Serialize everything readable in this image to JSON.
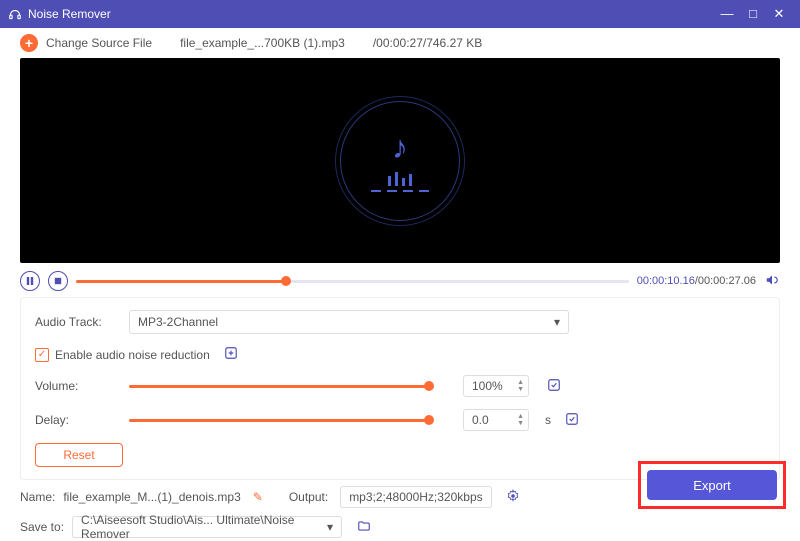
{
  "window": {
    "title": "Noise Remover"
  },
  "topbar": {
    "change_source": "Change Source File",
    "filename": "file_example_...700KB (1).mp3",
    "meta": "/00:00:27/746.27 KB"
  },
  "player": {
    "current": "00:00:10.16",
    "total": "/00:00:27.06",
    "progress_pct": 38
  },
  "audio_track": {
    "label": "Audio Track:",
    "value": "MP3-2Channel"
  },
  "noise": {
    "label": "Enable audio noise reduction",
    "checked": true
  },
  "volume": {
    "label": "Volume:",
    "value": "100%",
    "pct": 100
  },
  "delay": {
    "label": "Delay:",
    "value": "0.0",
    "unit": "s",
    "pct": 100
  },
  "reset": {
    "label": "Reset"
  },
  "name": {
    "label": "Name:",
    "value": "file_example_M...(1)_denois.mp3"
  },
  "output": {
    "label": "Output:",
    "value": "mp3;2;48000Hz;320kbps"
  },
  "saveto": {
    "label": "Save to:",
    "value": "C:\\Aiseesoft Studio\\Ais... Ultimate\\Noise Remover"
  },
  "export": {
    "label": "Export"
  }
}
